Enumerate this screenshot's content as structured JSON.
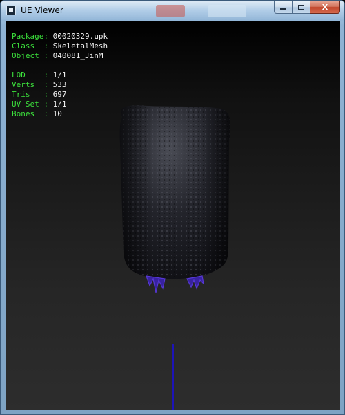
{
  "window": {
    "title": "UE Viewer",
    "buttons": {
      "minimize": "minimize",
      "maximize": "maximize",
      "close": "X"
    }
  },
  "info": {
    "package": {
      "key": "Package",
      "value": "00020329.upk"
    },
    "class": {
      "key": "Class  ",
      "value": "SkeletalMesh"
    },
    "object": {
      "key": "Object ",
      "value": "040081_JinM"
    },
    "lod": {
      "key": "LOD    ",
      "value": "1/1"
    },
    "verts": {
      "key": "Verts  ",
      "value": "533"
    },
    "tris": {
      "key": "Tris   ",
      "value": "697"
    },
    "uvset": {
      "key": "UV Set ",
      "value": "1/1"
    },
    "bones": {
      "key": "Bones  ",
      "value": "10"
    }
  },
  "colors": {
    "label_green": "#3ce13c",
    "value_white": "#f0f0f0",
    "axis_blue": "#1d14b8",
    "wire_violet": "#5a3adf"
  },
  "icons": {
    "app": "app-icon",
    "minimize": "minimize-icon",
    "maximize": "maximize-icon",
    "close": "close-icon"
  }
}
